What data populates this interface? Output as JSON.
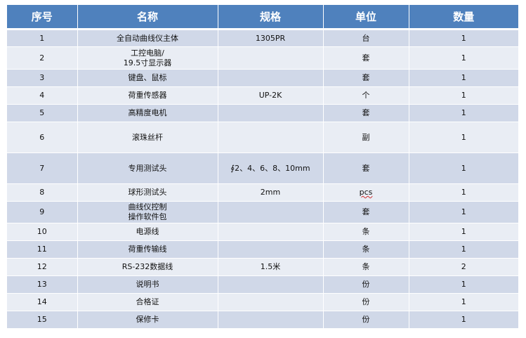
{
  "table": {
    "headers": [
      "序号",
      "名称",
      "规格",
      "单位",
      "数量"
    ],
    "rows": [
      {
        "no": "1",
        "name": "全自动曲线仪主体",
        "spec": "1305PR",
        "unit": "台",
        "qty": "1"
      },
      {
        "no": "2",
        "name": "工控电脑/\n19.5寸显示器",
        "spec": "",
        "unit": "套",
        "qty": "1"
      },
      {
        "no": "3",
        "name": "键盘、鼠标",
        "spec": "",
        "unit": "套",
        "qty": "1"
      },
      {
        "no": "4",
        "name": "荷重传感器",
        "spec": "UP-2K",
        "unit": "个",
        "qty": "1"
      },
      {
        "no": "5",
        "name": "高精度电机",
        "spec": "",
        "unit": "套",
        "qty": "1"
      },
      {
        "no": "6",
        "name": "滚珠丝杆",
        "spec": "",
        "unit": "副",
        "qty": "1"
      },
      {
        "no": "7",
        "name": "专用测试头",
        "spec": "∮2、4、6、8、10mm",
        "unit": "套",
        "qty": "1"
      },
      {
        "no": "8",
        "name": "球形测试头",
        "spec": "2mm",
        "unit": "pcs",
        "qty": "1"
      },
      {
        "no": "9",
        "name": "曲线仪控制\n操作软件包",
        "spec": "",
        "unit": "套",
        "qty": "1"
      },
      {
        "no": "10",
        "name": "电源线",
        "spec": "",
        "unit": "条",
        "qty": "1"
      },
      {
        "no": "11",
        "name": "荷重传输线",
        "spec": "",
        "unit": "条",
        "qty": "1"
      },
      {
        "no": "12",
        "name": "RS-232数据线",
        "spec": "1.5米",
        "unit": "条",
        "qty": "2"
      },
      {
        "no": "13",
        "name": "说明书",
        "spec": "",
        "unit": "份",
        "qty": "1"
      },
      {
        "no": "14",
        "name": "合格证",
        "spec": "",
        "unit": "份",
        "qty": "1"
      },
      {
        "no": "15",
        "name": "保修卡",
        "spec": "",
        "unit": "份",
        "qty": "1"
      }
    ]
  },
  "colors": {
    "header_bg": "#4f81bd",
    "row_odd": "#d0d8e8",
    "row_even": "#e9edf4"
  }
}
